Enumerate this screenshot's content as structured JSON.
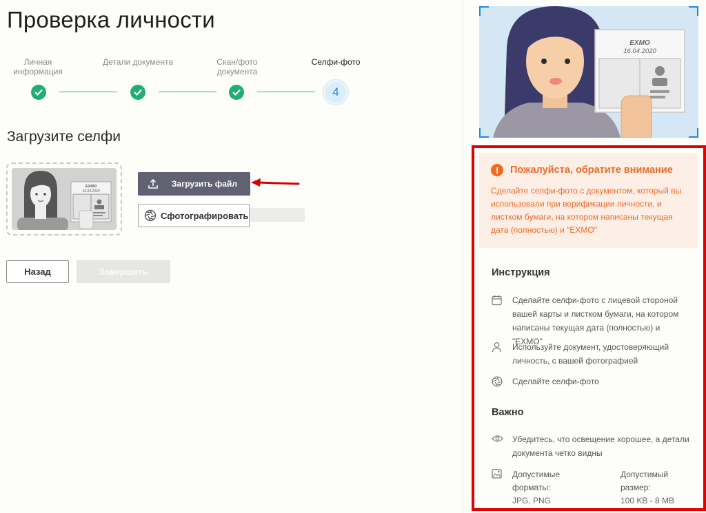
{
  "page": {
    "title": "Проверка личности"
  },
  "steps": [
    {
      "label": "Личная информация",
      "state": "done"
    },
    {
      "label": "Детали документа",
      "state": "done"
    },
    {
      "label": "Скан/фото документа",
      "state": "done"
    },
    {
      "label": "Селфи-фото",
      "state": "active",
      "number": "4"
    }
  ],
  "upload": {
    "section_title": "Загрузите селфи",
    "upload_button": "Загрузить файл",
    "photo_button": "Сфотографировать"
  },
  "nav": {
    "back": "Назад",
    "finish": "Завершить"
  },
  "illustration": {
    "doc_brand": "EXMO",
    "doc_date": "16.04.2020"
  },
  "alert": {
    "title": "Пожалуйста, обратите внимание",
    "text": "Сделайте селфи-фото с документом, который вы использовали при верификации личности, и листком бумаги, на котором написаны текущая дата (полностью) и \"EXMO\""
  },
  "instructions": {
    "title": "Инструкция",
    "items": [
      {
        "icon": "calendar-icon",
        "text": "Сделайте селфи-фото с лицевой стороной вашей карты и листком бумаги, на котором написаны текущая дата (полностью) и \"EXMO\""
      },
      {
        "icon": "person-icon",
        "text": "Используйте документ, удостоверяющий личность, с вашей фотографией"
      },
      {
        "icon": "aperture-icon",
        "text": "Сделайте селфи-фото"
      }
    ]
  },
  "important": {
    "title": "Важно",
    "items": [
      {
        "icon": "eye-icon",
        "text": "Убедитесь, что освещение хорошее, а детали документа четко видны"
      }
    ],
    "formats_label": "Допустимые форматы:",
    "formats_value": "JPG, PNG",
    "size_label": "Допустимый размер:",
    "size_value": "100 KB - 8 MB"
  },
  "colors": {
    "step_done": "#1fae74",
    "step_active": "#2b7fd4",
    "primary_button": "#626173",
    "alert_text": "#ef6a27",
    "highlight_border": "#e30000"
  }
}
